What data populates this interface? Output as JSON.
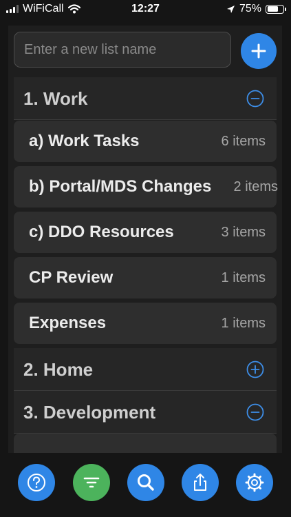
{
  "status_bar": {
    "carrier": "WiFiCall",
    "time": "12:27",
    "battery_percent": "75%",
    "battery_level": 0.75,
    "icons": [
      "signal-icon",
      "wifi-icon",
      "location-arrow-icon",
      "battery-icon"
    ]
  },
  "new_list": {
    "placeholder": "Enter a new list name",
    "add_icon": "plus-icon"
  },
  "groups": [
    {
      "title": "1. Work",
      "toggle_icon": "minus-circle-icon",
      "expanded": true,
      "lists": [
        {
          "name": "a) Work Tasks",
          "count": "6 items"
        },
        {
          "name": "b) Portal/MDS Changes",
          "count": "2 items"
        },
        {
          "name": "c) DDO Resources",
          "count": "3 items"
        },
        {
          "name": "CP Review",
          "count": "1 items"
        },
        {
          "name": "Expenses",
          "count": "1 items"
        }
      ]
    },
    {
      "title": "2. Home",
      "toggle_icon": "plus-circle-icon",
      "expanded": false,
      "lists": []
    },
    {
      "title": "3. Development",
      "toggle_icon": "minus-circle-icon",
      "expanded": true,
      "lists": []
    }
  ],
  "toolbar": {
    "buttons": [
      "help-icon",
      "filter-icon",
      "search-icon",
      "share-icon",
      "settings-icon"
    ]
  },
  "colors": {
    "accent_blue": "#2f86e6",
    "filter_green": "#4cb35c",
    "background": "#151515",
    "panel": "#1e1e1e",
    "group_row": "#262626",
    "list_row": "#2e2e2e"
  }
}
